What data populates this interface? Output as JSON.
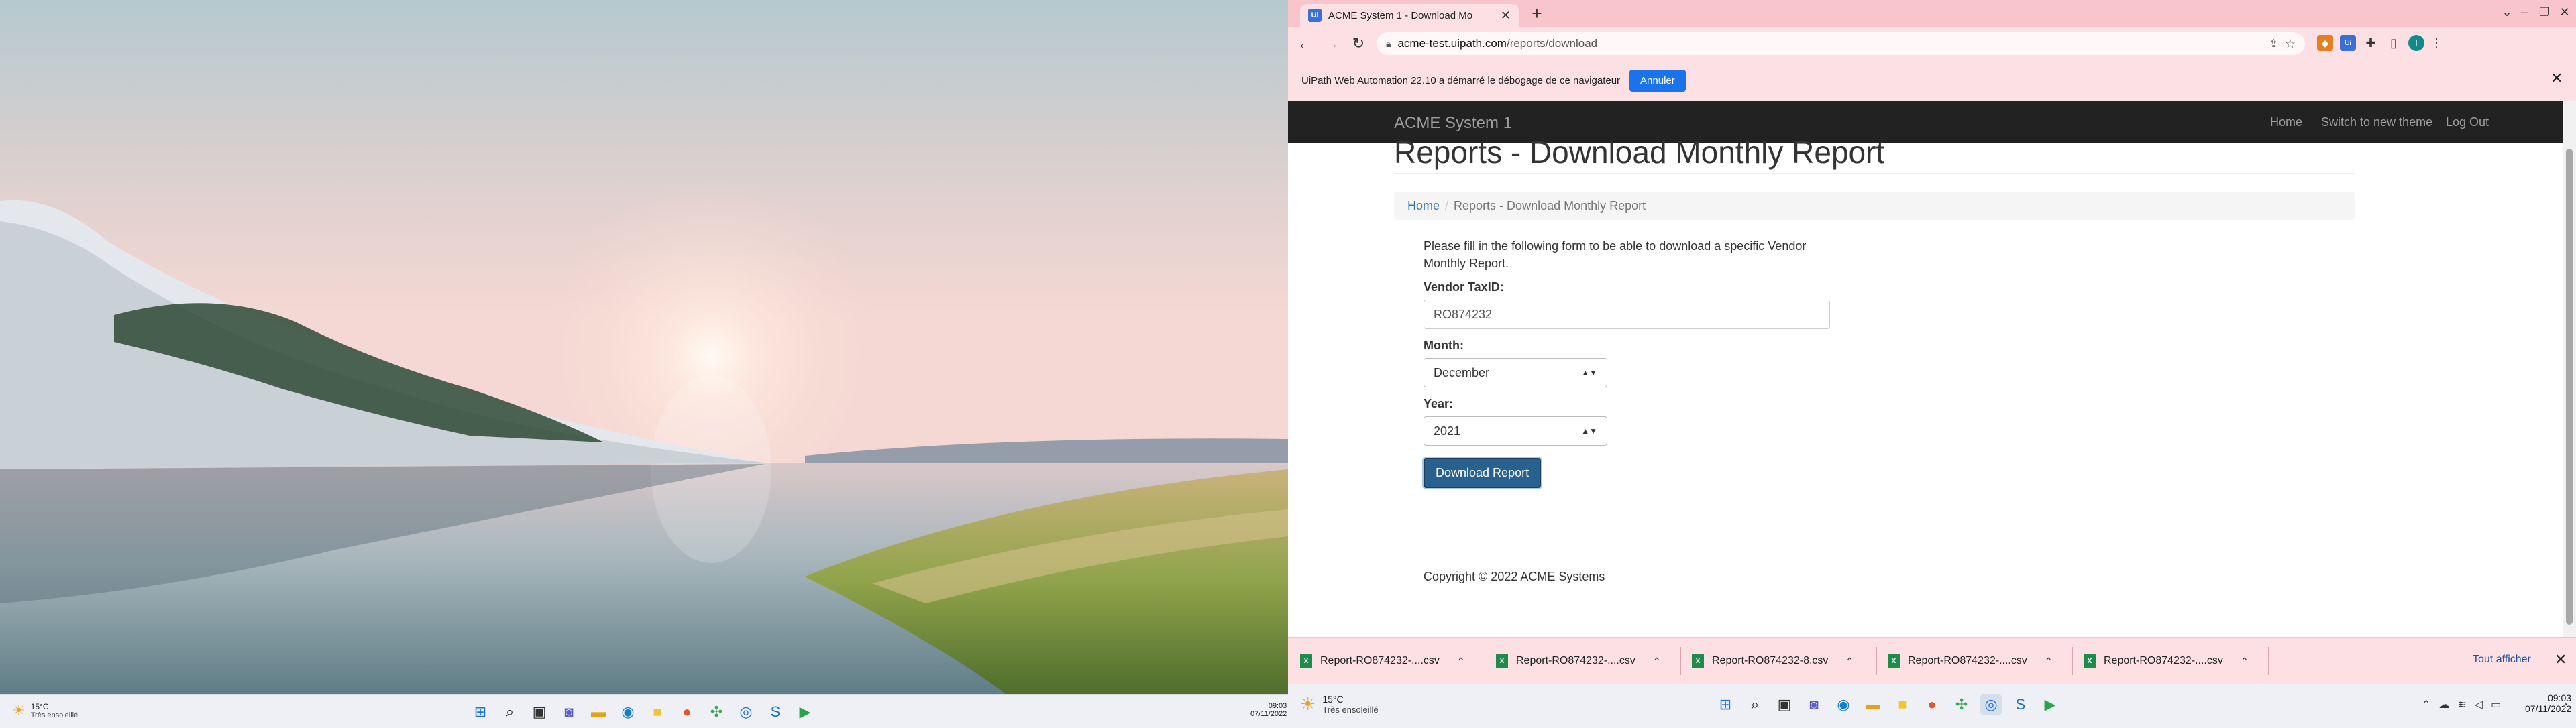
{
  "left_taskbar": {
    "weather_temp": "15°C",
    "weather_desc": "Très ensoleillé",
    "time": "09:03",
    "date": "07/11/2022"
  },
  "browser": {
    "tab_title": "ACME System 1 - Download Mo",
    "tab_favicon": "Ui",
    "url_host": "acme-test.uipath.com",
    "url_path": "/reports/download",
    "profile_initial": "I",
    "infobar_message": "UiPath Web Automation 22.10 a démarré le débogage de ce navigateur",
    "infobar_cancel": "Annuler"
  },
  "app": {
    "brand": "ACME System 1",
    "nav": [
      "Home",
      "Switch to new theme",
      "Log Out"
    ],
    "page_title": "Reports - Download Monthly Report",
    "breadcrumb_home": "Home",
    "breadcrumb_sep": "/",
    "breadcrumb_current": "Reports - Download Monthly Report",
    "instructions_line1": "Please fill in the following form to be able to download a specific Vendor",
    "instructions_line2": "Monthly Report.",
    "vendor_label": "Vendor TaxID:",
    "vendor_value": "RO874232",
    "month_label": "Month:",
    "month_value": "December",
    "year_label": "Year:",
    "year_value": "2021",
    "download_button": "Download Report",
    "copyright": "Copyright © 2022 ACME Systems"
  },
  "downloads": {
    "items": [
      "Report-RO874232-....csv",
      "Report-RO874232-....csv",
      "Report-RO874232-8.csv",
      "Report-RO874232-....csv",
      "Report-RO874232-....csv"
    ],
    "show_all": "Tout afficher",
    "file_badge": "X"
  },
  "right_taskbar": {
    "weather_temp": "15°C",
    "weather_desc": "Très ensoleillé",
    "time": "09:03",
    "date": "07/11/2022"
  },
  "colors": {
    "chrome_pink": "#f9c5cc",
    "navbar": "#222222",
    "primary_button": "#286090",
    "link": "#337ab7"
  }
}
